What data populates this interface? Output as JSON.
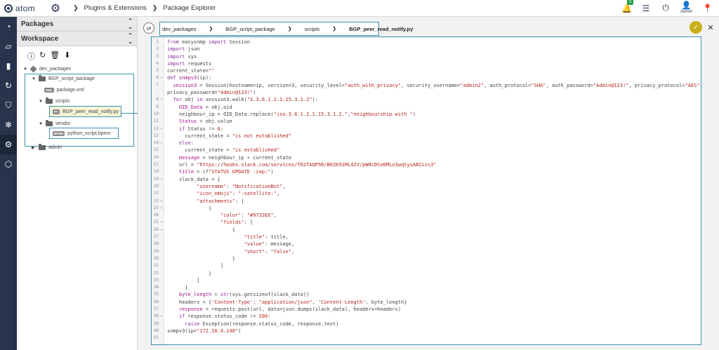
{
  "app": {
    "name": "atom"
  },
  "breadcrumb": {
    "items": [
      "Plugins & Extensions",
      "Package Explorer"
    ]
  },
  "topbar": {
    "notification_count": "0",
    "user_label": "Admin"
  },
  "sidebar": {
    "packages_label": "Packages",
    "workspace_label": "Workspace"
  },
  "tree": {
    "root": "dev_packages",
    "package": "BGP_script_package",
    "xml_tag": "XML",
    "xml_file": "package.xml",
    "scripts_folder": "scripts",
    "py_tag": "PY",
    "py_file": "BGP_peer_read_notify.py",
    "vendor_folder": "vendor",
    "bpmn_tag": "BPMN",
    "bpmn_file": "python_script.bpmn",
    "admin_folder": "admin"
  },
  "pathbar": {
    "items": [
      "dev_packages",
      "BGP_script_package",
      "scripts",
      "BGP_peer_read_notify.py"
    ]
  },
  "editor": {
    "line_numbers": [
      "1",
      "2",
      "3",
      "4",
      "5",
      "6",
      "7",
      "8",
      "9",
      "10",
      "11",
      "12",
      "13",
      "14",
      "15",
      "16",
      "17",
      "18",
      "19",
      "20",
      "21",
      "22",
      "23",
      "24",
      "25",
      "26",
      "27",
      "28",
      "29",
      "30",
      "31",
      "32",
      "33",
      "34",
      "35",
      "36",
      "37",
      "38",
      "39",
      "40",
      "41"
    ]
  },
  "colors": {
    "accent": "#3a8fb0",
    "rail": "#27344b",
    "confirm": "#c9b017",
    "badge": "#1e9e46"
  }
}
